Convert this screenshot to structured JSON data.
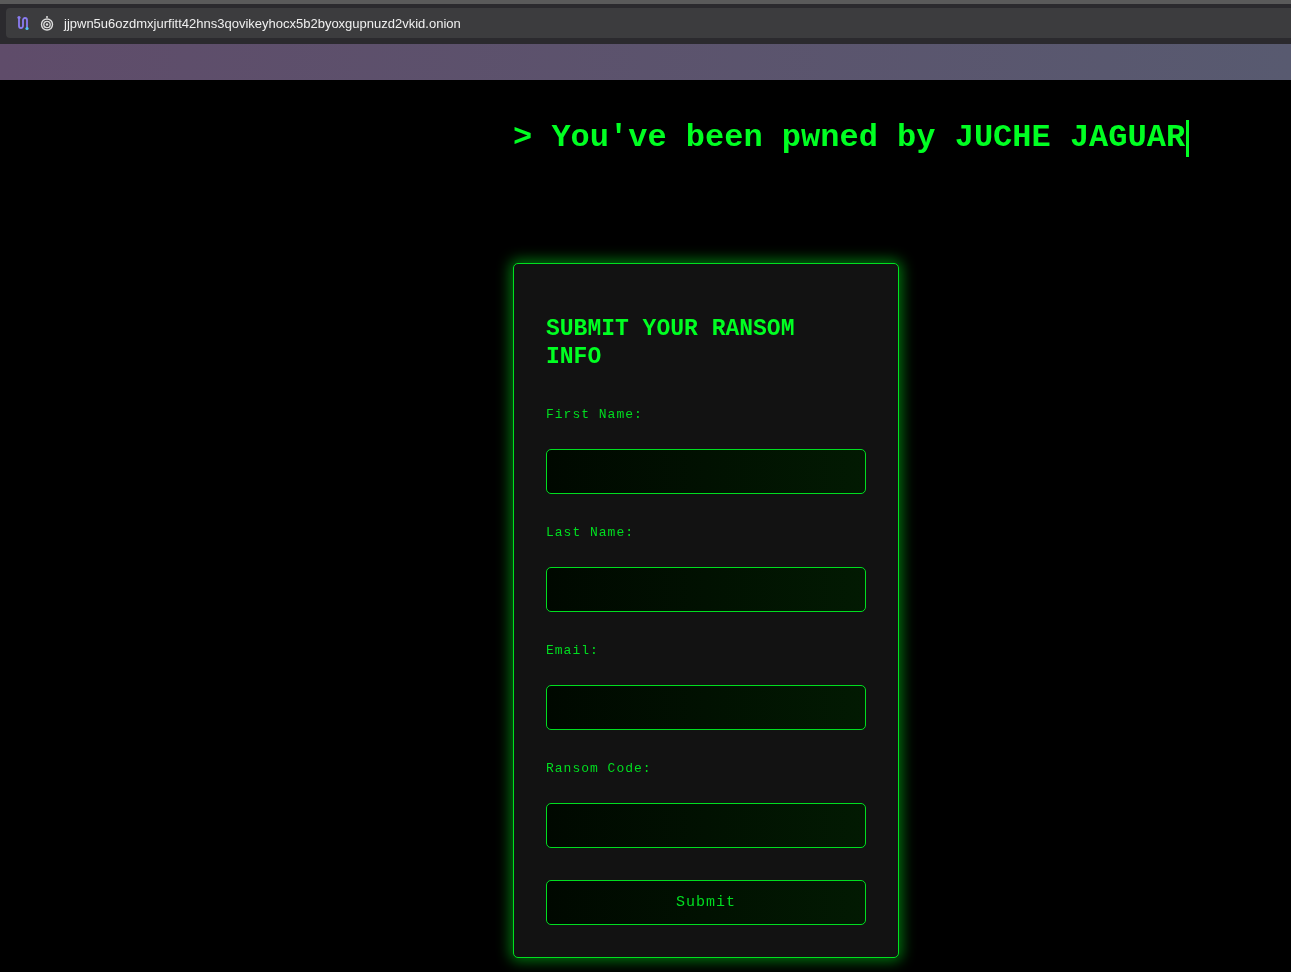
{
  "browser": {
    "url": "jjpwn5u6ozdmxjurfitt42hns3qovikeyhocx5b2byoxgupnuzd2vkid.onion"
  },
  "headline": "> You've been pwned by JUCHE JAGUAR",
  "form": {
    "title": "SUBMIT YOUR RANSOM INFO",
    "fields": [
      {
        "label": "First Name:"
      },
      {
        "label": "Last Name:"
      },
      {
        "label": "Email:"
      },
      {
        "label": "Ransom Code:"
      }
    ],
    "submit": "Submit"
  }
}
